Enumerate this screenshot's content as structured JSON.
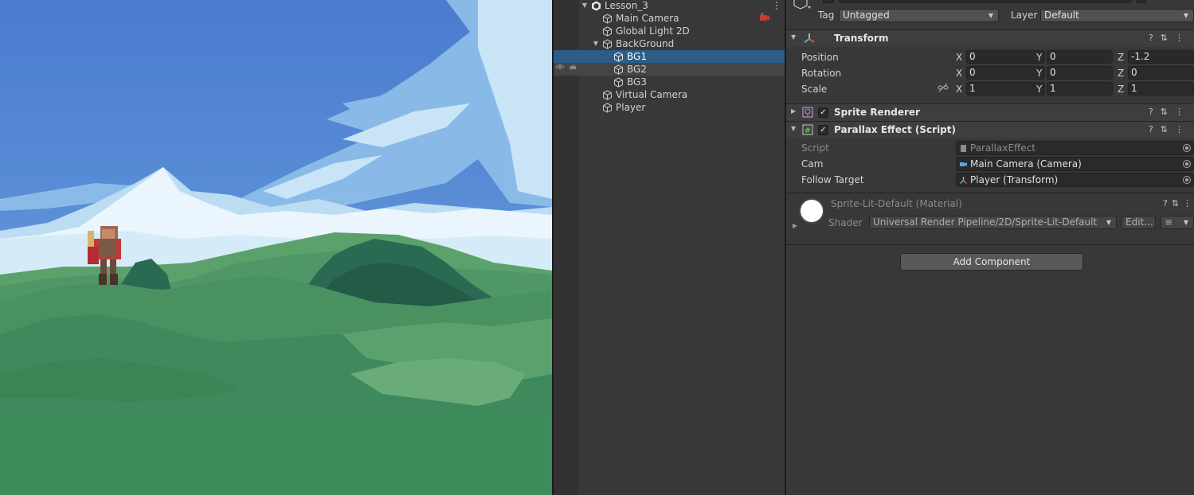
{
  "hierarchy": {
    "scene_name": "Lesson_3",
    "items": [
      {
        "label": "Main Camera"
      },
      {
        "label": "Global Light 2D"
      },
      {
        "label": "BackGround"
      },
      {
        "label": "BG1"
      },
      {
        "label": "BG2"
      },
      {
        "label": "BG3"
      },
      {
        "label": "Virtual Camera"
      },
      {
        "label": "Player"
      }
    ]
  },
  "inspector": {
    "tag_label": "Tag",
    "tag_value": "Untagged",
    "layer_label": "Layer",
    "layer_value": "Default",
    "transform": {
      "title": "Transform",
      "position": {
        "label": "Position",
        "x": "0",
        "y": "0",
        "z": "-1.2"
      },
      "rotation": {
        "label": "Rotation",
        "x": "0",
        "y": "0",
        "z": "0"
      },
      "scale": {
        "label": "Scale",
        "x": "1",
        "y": "1",
        "z": "1"
      },
      "axis_x": "X",
      "axis_y": "Y",
      "axis_z": "Z"
    },
    "sprite_renderer": {
      "title": "Sprite Renderer"
    },
    "parallax": {
      "title": "Parallax Effect (Script)",
      "script_label": "Script",
      "script_value": "ParallaxEffect",
      "cam_label": "Cam",
      "cam_value": "Main Camera (Camera)",
      "follow_label": "Follow Target",
      "follow_value": "Player (Transform)"
    },
    "material": {
      "title": "Sprite-Lit-Default (Material)",
      "shader_label": "Shader",
      "shader_value": "Universal Render Pipeline/2D/Sprite-Lit-Default",
      "edit_label": "Edit..."
    },
    "add_component_label": "Add Component"
  },
  "colors": {
    "selection": "#2c5d87",
    "panel": "#383838",
    "sky": "#4d7fcf",
    "hill": "#3a8c5e"
  }
}
